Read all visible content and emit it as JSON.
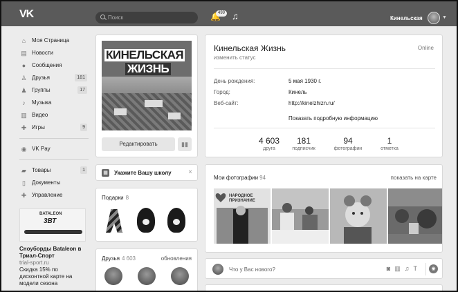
{
  "header": {
    "logo": "VK",
    "search_placeholder": "Поиск",
    "notifications_badge": "499",
    "user_name": "Кинельская"
  },
  "sidebar": {
    "items": [
      {
        "label": "Моя Страница",
        "icon": "home-icon",
        "count": ""
      },
      {
        "label": "Новости",
        "icon": "news-icon",
        "count": ""
      },
      {
        "label": "Сообщения",
        "icon": "messages-icon",
        "count": ""
      },
      {
        "label": "Друзья",
        "icon": "friends-icon",
        "count": "181"
      },
      {
        "label": "Группы",
        "icon": "groups-icon",
        "count": "17"
      },
      {
        "label": "Музыка",
        "icon": "music-icon",
        "count": ""
      },
      {
        "label": "Видео",
        "icon": "video-icon",
        "count": ""
      },
      {
        "label": "Игры",
        "icon": "games-icon",
        "count": "9"
      }
    ],
    "vkpay": "VK Pay",
    "items2": [
      {
        "label": "Товары",
        "icon": "goods-icon",
        "count": "1"
      },
      {
        "label": "Документы",
        "icon": "documents-icon",
        "count": ""
      },
      {
        "label": "Управление",
        "icon": "manage-icon",
        "count": ""
      }
    ],
    "ad": {
      "brand": "BATALEON",
      "logo_text": "3ВТ",
      "title": "Сноуборды Bataleon в Триал-Спорт",
      "source": "trial-sport.ru",
      "desc": "Скидка 15% по дисконтной карте на модели сезона"
    }
  },
  "avatar": {
    "title_line1": "КИНЕЛЬСКАЯ",
    "title_line2": "ЖИЗНЬ",
    "edit_label": "Редактировать"
  },
  "school": {
    "label": "Укажите Вашу школу"
  },
  "gifts": {
    "title": "Подарки",
    "count": "8"
  },
  "friends": {
    "title": "Друзья",
    "count": "4 603",
    "updates": "обновления"
  },
  "profile": {
    "name": "Кинельская Жизнь",
    "status": "изменить статус",
    "online": "Online",
    "birthday_label": "День рождения:",
    "birthday": "5 мая 1930 г.",
    "city_label": "Город:",
    "city": "Кинель",
    "site_label": "Веб-сайт:",
    "site": "http://kinelzhizn.ru/",
    "more": "Показать подробную информацию",
    "stats": [
      {
        "value": "4 603",
        "label": "друга"
      },
      {
        "value": "181",
        "label": "подписчик"
      },
      {
        "value": "94",
        "label": "фотографии"
      },
      {
        "value": "1",
        "label": "отметка"
      }
    ]
  },
  "photos": {
    "title": "Мои фотографии",
    "count": "94",
    "link": "показать на карте",
    "photo1_caption": "НАРОДНОЕ ПРИЗНАНИЕ"
  },
  "post": {
    "placeholder": "Что у Вас нового?"
  }
}
